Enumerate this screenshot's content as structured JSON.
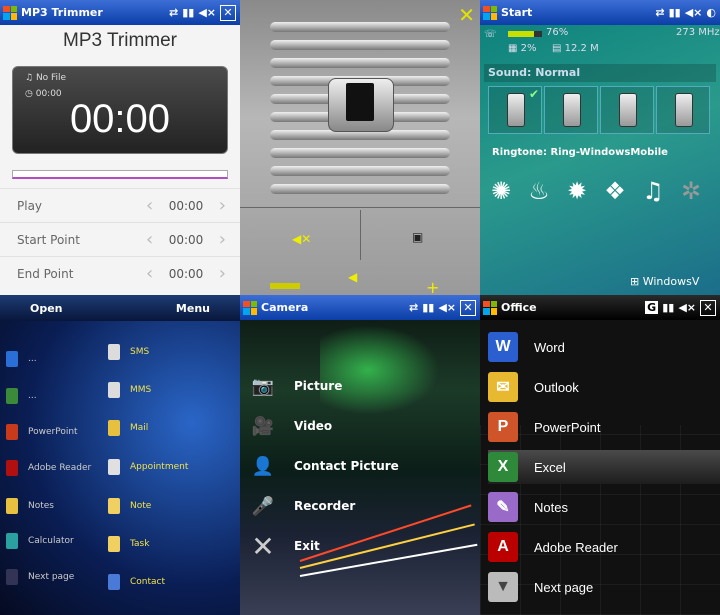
{
  "panel1": {
    "window_title": "MP3 Trimmer",
    "header": "MP3 Trimmer",
    "file": "No File",
    "elapsed_small": "00:00",
    "display_time": "00:00",
    "rows": [
      {
        "label": "Play",
        "value": "00:00"
      },
      {
        "label": "Start Point",
        "value": "00:00"
      },
      {
        "label": "End Point",
        "value": "00:00"
      }
    ]
  },
  "panel3": {
    "window_title": "Start",
    "battery": "76%",
    "cpu_speed": "273 MHz",
    "cpu_usage": "2%",
    "memory": "12.2 M",
    "sound_profile": "Sound: Normal",
    "ringtone": "Ringtone: Ring-WindowsMobile",
    "brand": "WindowsV"
  },
  "panel4": {
    "left_softkey": "Open",
    "right_softkey": "Menu",
    "left_items": [
      "...",
      "...",
      "PowerPoint",
      "Adobe Reader",
      "Notes",
      "Calculator",
      "Next page"
    ],
    "right_items": [
      "SMS",
      "MMS",
      "Mail",
      "Appointment",
      "Note",
      "Task",
      "Contact"
    ]
  },
  "panel5": {
    "window_title": "Camera",
    "items": [
      "Picture",
      "Video",
      "Contact Picture",
      "Recorder",
      "Exit"
    ]
  },
  "panel6": {
    "window_title": "Office",
    "items": [
      "Word",
      "Outlook",
      "PowerPoint",
      "Excel",
      "Notes",
      "Adobe Reader",
      "Next page"
    ],
    "selected_index": 3
  },
  "colors": {
    "titlebar": "#0b3ea8",
    "accent_yellow": "#e2e200",
    "progress_purple": "#b050c0"
  }
}
